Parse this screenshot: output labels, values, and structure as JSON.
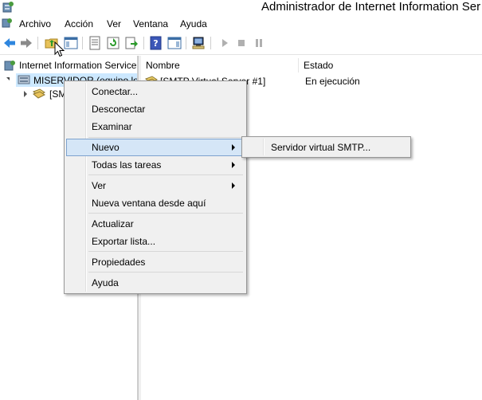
{
  "window": {
    "title": "Administrador de Internet Information Ser"
  },
  "menubar": {
    "items": [
      "Archivo",
      "Acción",
      "Ver",
      "Ventana",
      "Ayuda"
    ]
  },
  "toolbar": {
    "icons": [
      "back-icon",
      "forward-icon",
      "up-folder-icon",
      "show-hide-tree-icon",
      "properties-icon",
      "refresh-icon",
      "export-icon",
      "help-icon",
      "show-hide-action-icon",
      "computer-icon",
      "start-icon",
      "stop-icon",
      "pause-icon"
    ]
  },
  "tree": {
    "root": "Internet Information Service",
    "server": "MISERVIDOR (equipo loc",
    "child": "[SM"
  },
  "list": {
    "columns": [
      "Nombre",
      "Estado"
    ],
    "rows": [
      {
        "name": "[SMTP Virtual Server #1]",
        "status": "En ejecución"
      }
    ]
  },
  "context_menu": {
    "items": [
      {
        "label": "Conectar..."
      },
      {
        "label": "Desconectar"
      },
      {
        "label": "Examinar"
      },
      {
        "label": "Nuevo",
        "submenu": true,
        "highlighted": true
      },
      {
        "label": "Todas las tareas",
        "submenu": true
      },
      {
        "label": "Ver",
        "submenu": true
      },
      {
        "label": "Nueva ventana desde aquí"
      },
      {
        "label": "Actualizar"
      },
      {
        "label": "Exportar lista..."
      },
      {
        "label": "Propiedades"
      },
      {
        "label": "Ayuda"
      }
    ]
  },
  "submenu": {
    "items": [
      {
        "label": "Servidor virtual SMTP..."
      }
    ]
  },
  "colors": {
    "highlight": "#d5e6f7",
    "highlight_border": "#7da2ce",
    "menu_bg": "#f0f0f0",
    "selection": "#cce8ff"
  }
}
